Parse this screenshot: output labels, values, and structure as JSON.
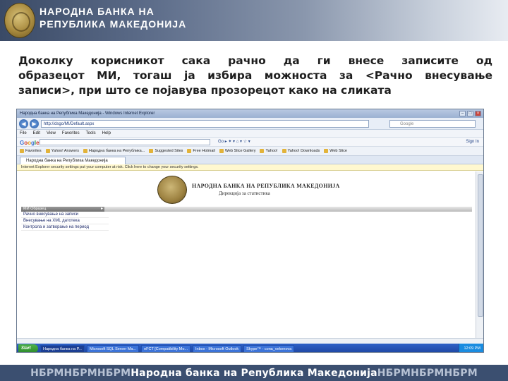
{
  "slide": {
    "bank_name_line1": "НАРОДНА БАНКА НА",
    "bank_name_line2": "РЕПУБЛИКА МАКЕДОНИЈА",
    "paragraph_line1": "Доколку корисникот сака рачно да ги внесе записите од",
    "paragraph_line2": "образецот МИ, тогаш ја избира можноста за <Рачно внесување",
    "paragraph_line3": "записи>, при што се појавува прозорецот како на сликата",
    "footer": {
      "left_repeat": "НБРМНБРМНБРМ",
      "center": "Народна банка на Република Македонија",
      "right_repeat": "НБРМНБРМНБРМ"
    },
    "colors": {
      "header_dark": "#3a4a66",
      "footer": "#3b4f70",
      "text": "#1e1e1e"
    }
  },
  "browser": {
    "window_title": "Народна банка на Република Македонија - Windows Internet Explorer",
    "url": "http://dsgo/MI/Default.aspx",
    "search_placeholder": "Google",
    "menu": [
      "File",
      "Edit",
      "View",
      "Favorites",
      "Tools",
      "Help"
    ],
    "google_label": "Google",
    "google_tools": "Go ▸ ✦ ▾  ⌂ ▾  ☆ ▾",
    "google_right": "Sign In",
    "favorites": [
      "Favorites",
      "Yahoo! Answers",
      "Народна банка на Република...",
      "Suggested Sites",
      "Free Hotmail",
      "Web Slice Gallery",
      "Yahoo!",
      "Yahoo! Downloads",
      "Web Slice"
    ],
    "tab_title": "Народна банка на Република Македонија",
    "info_bar": "Internet Explorer security settings put your computer at risk. Click here to change your security settings.",
    "page": {
      "title": "НАРОДНА БАНКА НА РЕПУБЛИКА МАКЕДОНИЈА",
      "subtitle": "Дирекција за статистика",
      "menu_header": "МИ Образец",
      "menu_items": [
        "Рачно внесување на записи",
        "Внесување на XML датотека",
        "Контрола и затворање на период"
      ]
    },
    "taskbar": {
      "start": "Start",
      "items": [
        "Народна банка на Р...",
        "Microsoft SQL Server Ma...",
        "eFCT [Compatibility Mo...",
        "Inbox - Microsoft Outlook",
        "Skype™ - сопa_vekenova"
      ],
      "tray_time": "12:09 PM"
    }
  }
}
